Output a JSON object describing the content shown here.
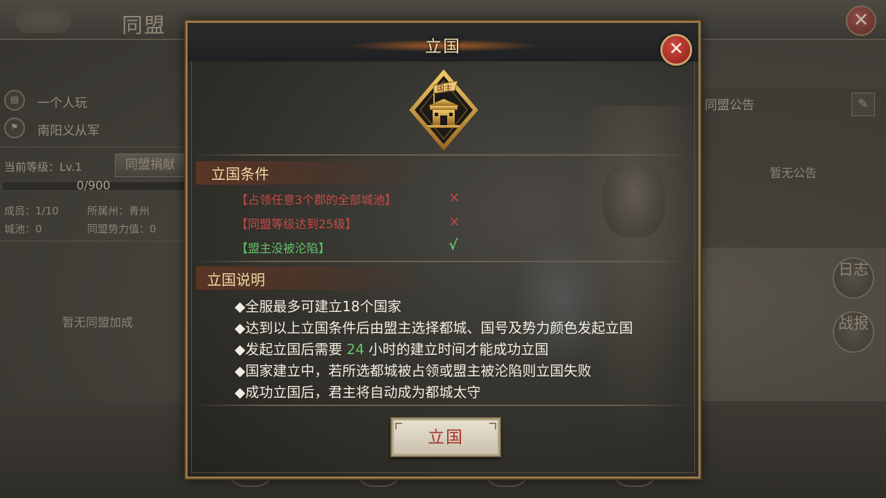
{
  "background": {
    "title": "同盟",
    "close_glyph": "✕",
    "player_name": "一个人玩",
    "leader_name": "南阳义从军",
    "level_label": "当前等级：Lv.1",
    "donate_label": "同盟捐献",
    "progress_text": "0/900",
    "progress_fraction": 0,
    "members": "成员：1/10",
    "state": "所属州：青州",
    "cities": "城池：0",
    "power": "同盟势力值：0",
    "no_bonus": "暂无同盟加成",
    "announcement_title": "同盟公告",
    "no_announcement": "暂无公告",
    "log_button": "日志",
    "report_button": "战报"
  },
  "modal": {
    "title": "立国",
    "close_glyph": "✕",
    "emblem_text": "国主",
    "conditions_title": "立国条件",
    "conditions": [
      {
        "text": "【占领任意3个郡的全部城池】",
        "status": "×",
        "met": false
      },
      {
        "text": "【同盟等级达到25级】",
        "status": "×",
        "met": false
      },
      {
        "text": "【盟主没被沦陷】",
        "status": "√",
        "met": true
      }
    ],
    "notes_title": "立国说明",
    "notes": [
      "◆全服最多可建立18个国家",
      "◆达到以上立国条件后由盟主选择都城、国号及势力颜色发起立国",
      "◆发起立国后需要 ",
      "◆国家建立中，若所选都城被占领或盟主被沦陷则立国失败",
      "◆成功立国后，君主将自动成为都城太守"
    ],
    "note3_hours": "24",
    "note3_suffix": " 小时的建立时间才能成功立国",
    "confirm_label": "立国"
  },
  "colors": {
    "unmet": "#c64a44",
    "met": "#62c36a",
    "title_gold": "#f0d8a4",
    "frame_gold": "#9a7a46"
  }
}
